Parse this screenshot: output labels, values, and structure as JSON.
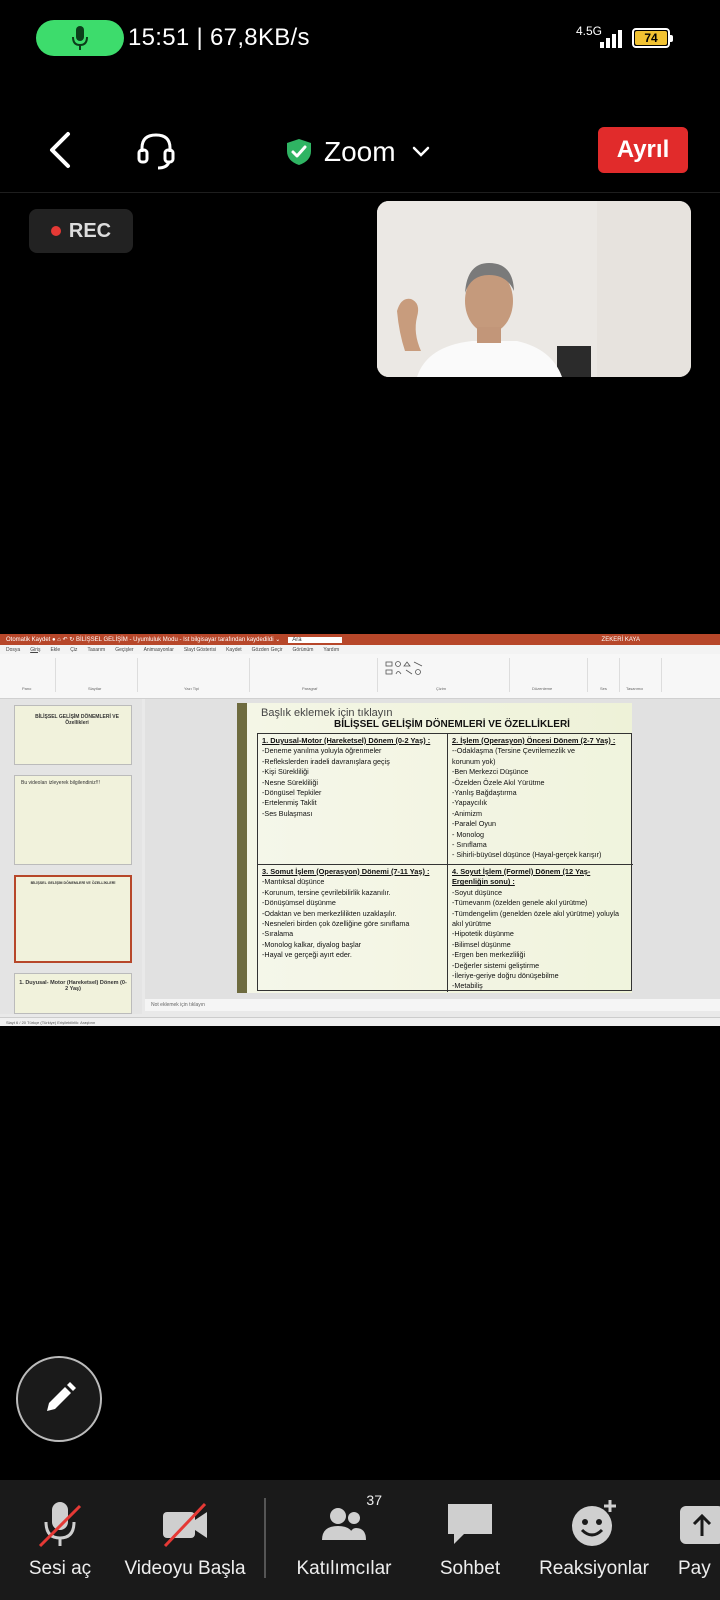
{
  "status_bar": {
    "status_text": "15:51 | 67,8KB/s",
    "network": "4.5G",
    "battery": "74"
  },
  "app_bar": {
    "title": "Zoom",
    "leave_label": "Ayrıl"
  },
  "recording": {
    "label": "REC"
  },
  "ppt": {
    "title_bar": "Otomatik Kaydet  ●  ⌂ ↶ ↻  BİLİŞSEL GELİŞİM - Uyumluluk Modu - Ist bilgisayar tarafından kaydedildi ⌄",
    "search_text": "Ara",
    "user_text": "ZEKERİ KAYA",
    "tabs": [
      "Dosya",
      "Giriş",
      "Ekle",
      "Çiz",
      "Tasarım",
      "Geçişler",
      "Animasyonlar",
      "Slayt Gösterisi",
      "Kaydet",
      "Gözden Geçir",
      "Görünüm",
      "Yardım"
    ],
    "ribbon_groups": [
      "Pano",
      "Slaytlar",
      "Yazı Tipi",
      "Paragraf",
      "Çizim",
      "Düzenleme",
      "Ses",
      "Tasarımcı"
    ],
    "thumbnails": [
      {
        "num": "4",
        "title": "BİLİŞSEL GELİŞİM DÖNEMLERİ VE Özellikleri"
      },
      {
        "num": "5",
        "title": "Bu videoları izleyerek bilgilendiniz!!!"
      },
      {
        "num": "6",
        "title": "BİLİŞSEL GELİŞİM DÖNEMLERİ VE ÖZELLİKLERİ"
      },
      {
        "num": "7",
        "title": "1. Duyusal- Motor (Hareketsel) Dönem (0-2 Yaş)"
      }
    ],
    "slide": {
      "placeholder": "Başlık eklemek için tıklayın",
      "title": "BİLİŞSEL GELİŞİM DÖNEMLERİ VE ÖZELLİKLERİ",
      "cells": [
        {
          "heading": "1. Duyusal-Motor (Hareketsel) Dönem (0-2 Yaş) :",
          "items": [
            "-Deneme yanılma yoluyla öğrenmeler",
            "-Reflekslerden iradeli davranışlara geçiş",
            "-Kişi Sürekliliği",
            "-Nesne Sürekliliği",
            "-Döngüsel Tepkiler",
            "-Ertelenmiş Taklit",
            "-Ses Bulaşması"
          ]
        },
        {
          "heading": "2. İşlem (Operasyon) Öncesi Dönem (2-7 Yaş) :",
          "items": [
            "--Odaklaşma                    (Tersine Çevrilemezlik  ve",
            "korunum yok)",
            "-Ben Merkezci Düşünce",
            "-Özelden Özele Akıl Yürütme",
            "-Yanlış Bağdaştırma",
            "-Yapaycılık",
            "-Animizm",
            "-Paralel Oyun",
            " - Monolog",
            " - Sınıflama",
            " - Sihirli-büyüsel düşünce (Hayal-gerçek karışır)"
          ]
        },
        {
          "heading": "3. Somut İşlem (Operasyon) Dönemi (7-11 Yaş) :",
          "items": [
            "-Mantıksal düşünce",
            "-Korunum, tersine çevrilebilirlik kazanılır.",
            "-Dönüşümsel düşünme",
            "-Odaktan ve ben merkezlilikten uzaklaşılır.",
            "-Nesneleri birden çok özelliğine göre sınıflama",
            "-Sıralama",
            "-Monolog kalkar, diyalog başlar",
            "-Hayal ve gerçeği ayırt eder."
          ]
        },
        {
          "heading": "4. Soyut İşlem (Formel) Dönem (12 Yaş-Ergenliğin sonu) :",
          "items": [
            "-Soyut düşünce",
            "-Tümevarım (özelden genele akıl yürütme)",
            "-Tümdengelim (genelden özele akıl yürütme) yoluyla",
            "akıl yürütme",
            "-Hipotetik düşünme",
            "-Bilimsel düşünme",
            "-Ergen ben merkezliliği",
            "-Değerler sistemi geliştirme",
            "-İleriye-geriye doğru dönüşebilme",
            "-Metabiliş"
          ]
        }
      ]
    },
    "notes_text": "Not eklemek için tıklayın",
    "status_text": "Slayt 6 / 20     Türkçe (Türkiye)     Erişilebilirlik: Araştırın"
  },
  "toolbar": {
    "mute_label": "Sesi aç",
    "video_label": "Videoyu Başla",
    "participants_label": "Katılımcılar",
    "participants_count": "37",
    "chat_label": "Sohbet",
    "reactions_label": "Reaksiyonlar",
    "share_label": "Pay"
  },
  "colors": {
    "leave": "#e12b2b",
    "mic_pill": "#3ddc6c",
    "battery": "#f1c232",
    "shield": "#2fb463",
    "ppt_brand": "#b7472a"
  }
}
